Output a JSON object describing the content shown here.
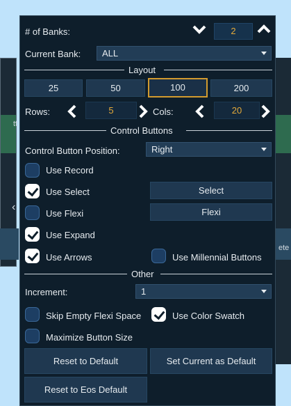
{
  "background": {
    "left_text": "tt",
    "right_text": "ete"
  },
  "banks": {
    "label": "# of Banks:",
    "value": "2"
  },
  "current_bank": {
    "label": "Current Bank:",
    "value": "ALL"
  },
  "layout": {
    "title": "Layout",
    "options": [
      "25",
      "50",
      "100",
      "200"
    ],
    "selected": "100",
    "rows_label": "Rows:",
    "rows_value": "5",
    "cols_label": "Cols:",
    "cols_value": "20"
  },
  "control_buttons": {
    "title": "Control Buttons",
    "position_label": "Control Button Position:",
    "position_value": "Right",
    "use_record": {
      "label": "Use Record",
      "checked": false
    },
    "use_select": {
      "label": "Use Select",
      "checked": true,
      "button": "Select"
    },
    "use_flexi": {
      "label": "Use Flexi",
      "checked": false,
      "button": "Flexi"
    },
    "use_expand": {
      "label": "Use Expand",
      "checked": true
    },
    "use_arrows": {
      "label": "Use Arrows",
      "checked": true
    },
    "use_millennial": {
      "label": "Use Millennial Buttons",
      "checked": false
    }
  },
  "other": {
    "title": "Other",
    "increment_label": "Increment:",
    "increment_value": "1",
    "skip_empty": {
      "label": "Skip Empty Flexi Space",
      "checked": false
    },
    "use_color_swatch": {
      "label": "Use Color Swatch",
      "checked": true
    },
    "maximize": {
      "label": "Maximize Button Size",
      "checked": false
    }
  },
  "actions": {
    "reset_default": "Reset to Default",
    "set_current_default": "Set Current as Default",
    "reset_eos_default": "Reset to Eos Default"
  },
  "colors": {
    "accent": "#d39b2e",
    "number": "#e3a93a",
    "panel": "#0e1e2b"
  }
}
